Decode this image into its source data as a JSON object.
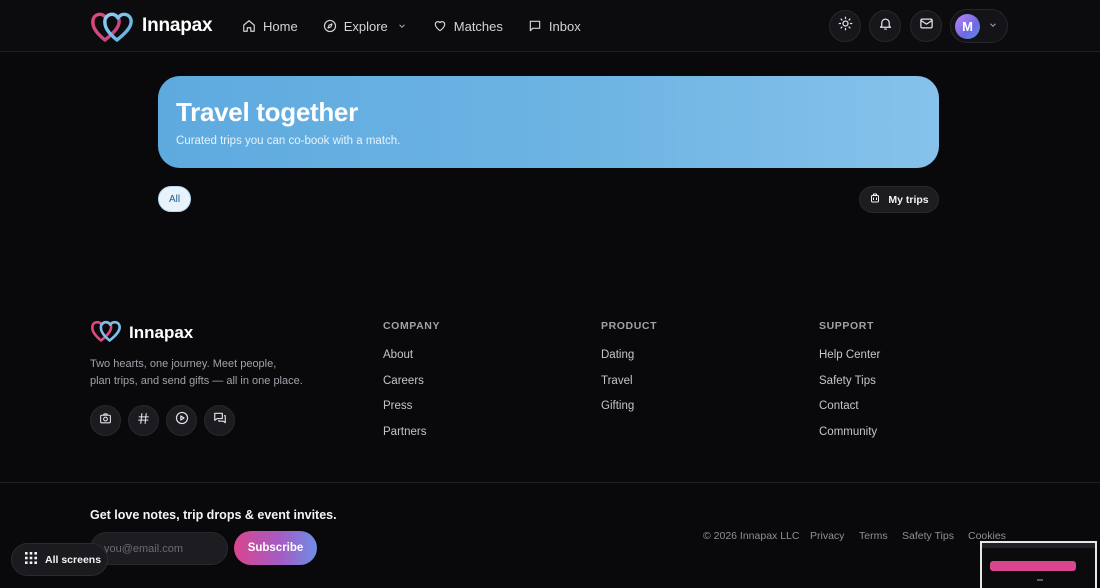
{
  "app": {
    "brand_name": "Innapax",
    "accent_pink": "#e0487f",
    "accent_blue": "#5eaadf"
  },
  "nav": {
    "items": [
      {
        "label": "Home",
        "icon": "home-icon"
      },
      {
        "label": "Explore",
        "icon": "compass-icon",
        "has_dropdown": true
      },
      {
        "label": "Matches",
        "icon": "heart-icon"
      },
      {
        "label": "Inbox",
        "icon": "message-square-icon"
      }
    ],
    "actions": [
      "sun-icon",
      "bell-icon",
      "mail-icon"
    ],
    "user_initial": "M"
  },
  "hero": {
    "title": "Travel together",
    "subtitle": "Curated trips you can co-book with a match."
  },
  "filters": {
    "active_chip": "All",
    "my_trips_label": "My trips"
  },
  "footer": {
    "brand_name": "Innapax",
    "tagline_line1": "Two hearts, one journey. Meet people,",
    "tagline_line2": "plan trips, and send gifts — all in one place.",
    "socials": [
      "camera-icon",
      "hash-icon",
      "play-icon",
      "chat-icon"
    ],
    "columns": [
      {
        "heading": "COMPANY",
        "links": [
          "About",
          "Careers",
          "Press",
          "Partners"
        ]
      },
      {
        "heading": "PRODUCT",
        "links": [
          "Dating",
          "Travel",
          "Gifting"
        ]
      },
      {
        "heading": "SUPPORT",
        "links": [
          "Help Center",
          "Safety Tips",
          "Contact",
          "Community"
        ]
      }
    ],
    "newsletter": {
      "title": "Get love notes, trip drops & event invites.",
      "email_placeholder": "you@email.com",
      "subscribe_label": "Subscribe"
    },
    "copyright": "© 2026 Innapax LLC",
    "legal_links": [
      "Privacy",
      "Terms",
      "Safety Tips",
      "Cookies"
    ]
  },
  "overlay": {
    "all_screens_label": "All screens"
  }
}
